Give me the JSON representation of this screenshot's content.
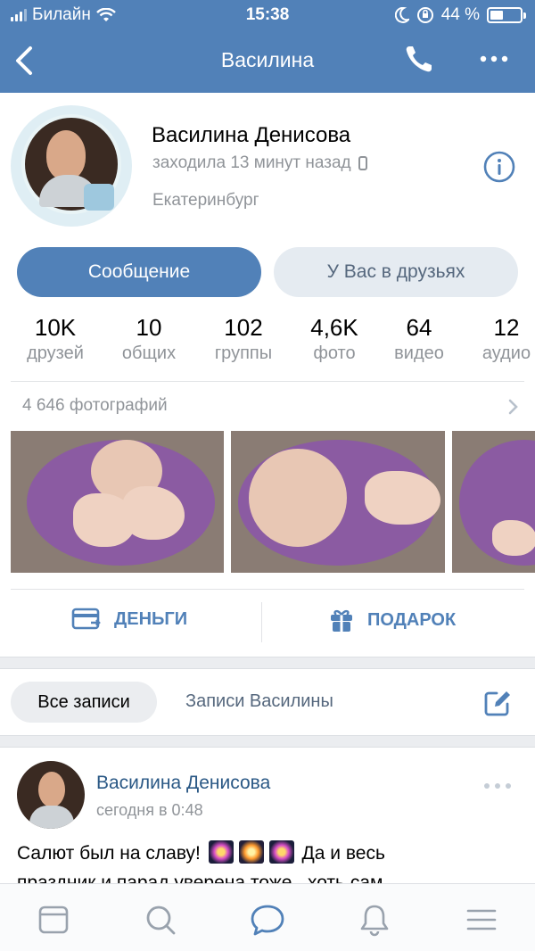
{
  "status_bar": {
    "carrier": "Билайн",
    "time": "15:38",
    "battery": "44 %",
    "battery_level": 0.44
  },
  "nav": {
    "title": "Василина",
    "icons": [
      "back-chevron-icon",
      "phone-icon",
      "more-dots-icon"
    ]
  },
  "profile": {
    "name": "Василина Денисова",
    "last_seen": "заходила 13 минут назад",
    "city": "Екатеринбург",
    "message_button": "Сообщение",
    "friends_button": "У Вас в друзьях"
  },
  "counters": [
    {
      "value": "10K",
      "label": "друзей"
    },
    {
      "value": "10",
      "label": "общих"
    },
    {
      "value": "102",
      "label": "группы"
    },
    {
      "value": "4,6K",
      "label": "фото"
    },
    {
      "value": "64",
      "label": "видео"
    },
    {
      "value": "12",
      "label": "аудио"
    }
  ],
  "photos": {
    "header": "4 646 фотографий"
  },
  "actions": {
    "money": "ДЕНЬГИ",
    "gift": "ПОДАРОК"
  },
  "wall": {
    "tab_all": "Все записи",
    "tab_own": "Записи Василины"
  },
  "post": {
    "author": "Василина Денисова",
    "time": "сегодня в 0:48",
    "text_before": "Салют был на славу!",
    "text_after": "Да и весь",
    "text_line2": "праздник и парад уверена тоже , хоть сам"
  },
  "tabbar": {
    "items": [
      "news-icon",
      "search-icon",
      "messages-icon",
      "notifications-icon",
      "menu-icon"
    ],
    "active": "messages-icon"
  },
  "colors": {
    "accent": "#5181b8",
    "link": "#2a5885",
    "secondary_text": "#909499",
    "light_button": "#e5ebf1"
  }
}
